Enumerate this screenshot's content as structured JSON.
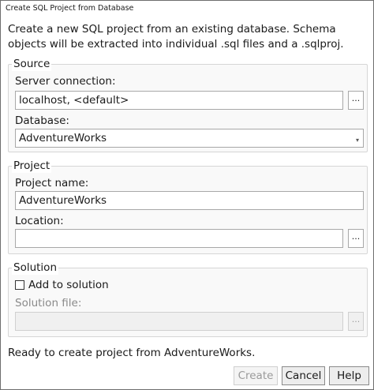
{
  "window": {
    "title": "Create SQL Project from Database"
  },
  "intro": "Create a new SQL project from an existing database. Schema objects will be extracted into individual .sql files and a .sqlproj.",
  "source": {
    "title": "Source",
    "server_label": "Server connection:",
    "server_value": "localhost, <default>",
    "browse_label": "...",
    "database_label": "Database:",
    "database_value": "AdventureWorks"
  },
  "project": {
    "title": "Project",
    "name_label": "Project name:",
    "name_value": "AdventureWorks",
    "location_label": "Location:",
    "location_value": "",
    "browse_label": "..."
  },
  "solution": {
    "title": "Solution",
    "add_label": "Add to solution",
    "add_checked": false,
    "file_label": "Solution file:",
    "file_value": "",
    "browse_label": "..."
  },
  "status": "Ready to create project from AdventureWorks.",
  "buttons": {
    "create": "Create",
    "cancel": "Cancel",
    "help": "Help"
  }
}
